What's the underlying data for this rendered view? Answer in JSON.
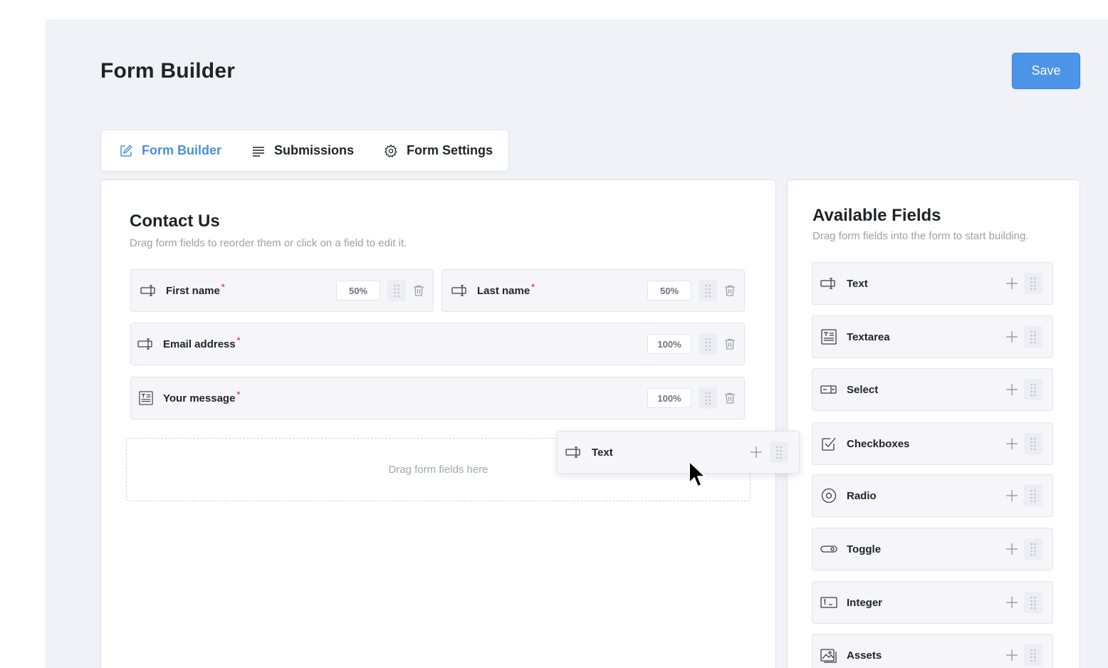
{
  "header": {
    "title": "Form Builder",
    "save_label": "Save"
  },
  "tabs": [
    {
      "label": "Form Builder",
      "icon": "edit-icon",
      "active": true
    },
    {
      "label": "Submissions",
      "icon": "list-icon",
      "active": false
    },
    {
      "label": "Form Settings",
      "icon": "gear-icon",
      "active": false
    }
  ],
  "form": {
    "title": "Contact Us",
    "description": "Drag form fields to reorder them or click on a field to edit it.",
    "fields": [
      {
        "label": "First name",
        "required_mark": "*",
        "width": "50%",
        "icon": "text-field-icon"
      },
      {
        "label": "Last name",
        "required_mark": "*",
        "width": "50%",
        "icon": "text-field-icon"
      },
      {
        "label": "Email address",
        "required_mark": "*",
        "width": "100%",
        "icon": "text-field-icon"
      },
      {
        "label": "Your message",
        "required_mark": "*",
        "width": "100%",
        "icon": "textarea-icon"
      }
    ],
    "dropzone_text": "Drag form fields here",
    "dragging_item": {
      "label": "Text",
      "icon": "text-field-icon"
    }
  },
  "available": {
    "title": "Available Fields",
    "description": "Drag form fields into the form to start building.",
    "items": [
      {
        "label": "Text",
        "icon": "text-field-icon"
      },
      {
        "label": "Textarea",
        "icon": "textarea-icon"
      },
      {
        "label": "Select",
        "icon": "select-icon"
      },
      {
        "label": "Checkboxes",
        "icon": "checkbox-icon"
      },
      {
        "label": "Radio",
        "icon": "radio-icon"
      },
      {
        "label": "Toggle",
        "icon": "toggle-icon"
      },
      {
        "label": "Integer",
        "icon": "integer-icon"
      },
      {
        "label": "Assets",
        "icon": "image-icon"
      }
    ]
  },
  "colors": {
    "accent": "#4a90d9",
    "save_button": "#4b94e8",
    "required": "#e5484d",
    "background": "#f0f2f7"
  }
}
